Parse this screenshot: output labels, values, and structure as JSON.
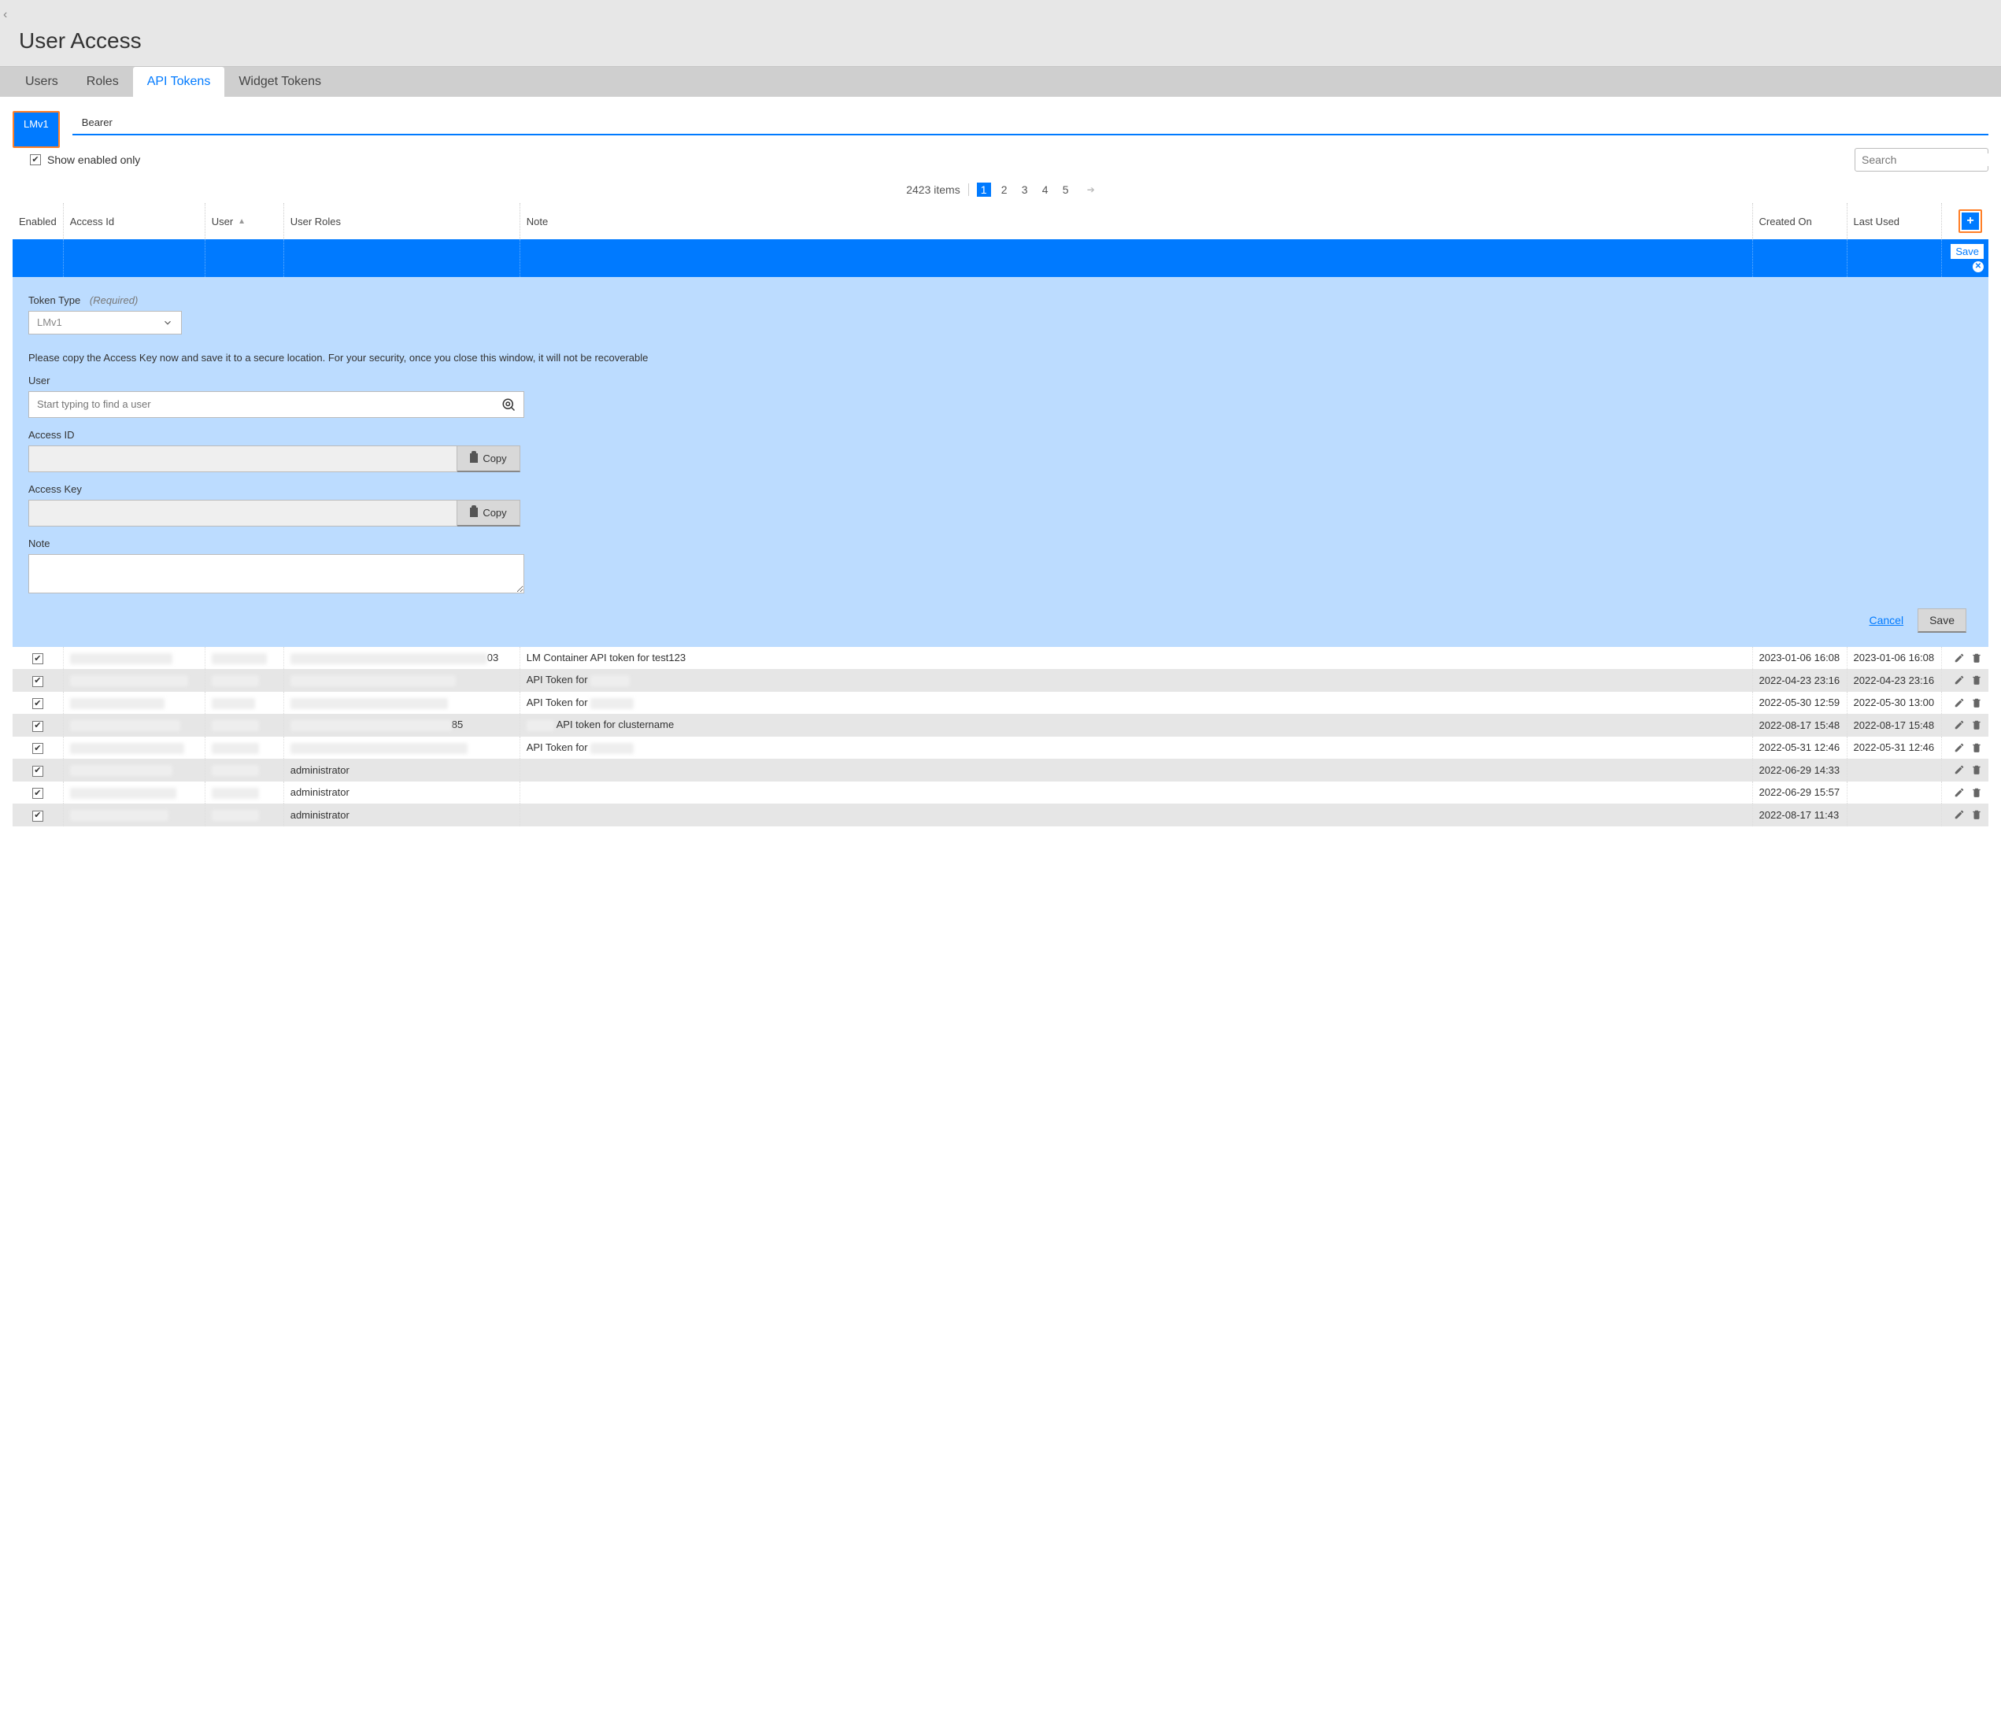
{
  "page_title": "User Access",
  "main_tabs": [
    "Users",
    "Roles",
    "API Tokens",
    "Widget Tokens"
  ],
  "active_main_tab": 2,
  "sub_tabs": [
    "LMv1",
    "Bearer"
  ],
  "active_sub_tab": 0,
  "show_enabled_only_label": "Show enabled only",
  "show_enabled_only_checked": true,
  "search_placeholder": "Search",
  "items_count_label": "2423 items",
  "pages": [
    "1",
    "2",
    "3",
    "4",
    "5"
  ],
  "active_page": 0,
  "columns": {
    "enabled": "Enabled",
    "access_id": "Access Id",
    "user": "User",
    "user_roles": "User Roles",
    "note": "Note",
    "created_on": "Created On",
    "last_used": "Last Used"
  },
  "inline_save_label": "Save",
  "form": {
    "token_type_label": "Token Type",
    "required_label": "(Required)",
    "token_type_value": "LMv1",
    "hint_text": "Please copy the Access Key now and save it to a secure location. For your security, once you close this window, it will not be recoverable",
    "user_label": "User",
    "user_placeholder": "Start typing to find a user",
    "access_id_label": "Access ID",
    "access_key_label": "Access Key",
    "copy_label": "Copy",
    "note_label": "Note",
    "cancel_label": "Cancel",
    "save_label": "Save"
  },
  "rows": [
    {
      "enabled": true,
      "access_id_width": 130,
      "user_width": 70,
      "roles_width": 250,
      "roles_suffix": "03",
      "note": "LM Container API token for test123",
      "created": "2023-01-06 16:08",
      "last_used": "2023-01-06 16:08"
    },
    {
      "enabled": true,
      "access_id_width": 150,
      "user_width": 60,
      "roles_width": 210,
      "roles_suffix": "",
      "note": "API Token for ",
      "note_redact": 50,
      "created": "2022-04-23 23:16",
      "last_used": "2022-04-23 23:16"
    },
    {
      "enabled": true,
      "access_id_width": 120,
      "user_width": 55,
      "roles_width": 200,
      "roles_suffix": "",
      "note": "API Token for ",
      "note_redact": 55,
      "created": "2022-05-30 12:59",
      "last_used": "2022-05-30 13:00"
    },
    {
      "enabled": true,
      "access_id_width": 140,
      "user_width": 60,
      "roles_width": 205,
      "roles_suffix": "85",
      "note_prefix_redact": 35,
      "note": "API token for clustername",
      "created": "2022-08-17 15:48",
      "last_used": "2022-08-17 15:48"
    },
    {
      "enabled": true,
      "access_id_width": 145,
      "user_width": 60,
      "roles_width": 225,
      "roles_suffix": "",
      "note": "API Token for ",
      "note_redact": 55,
      "created": "2022-05-31 12:46",
      "last_used": "2022-05-31 12:46"
    },
    {
      "enabled": true,
      "access_id_width": 130,
      "user_width": 60,
      "roles_text": "administrator",
      "note": "",
      "created": "2022-06-29 14:33",
      "last_used": ""
    },
    {
      "enabled": true,
      "access_id_width": 135,
      "user_width": 60,
      "roles_text": "administrator",
      "note": "",
      "created": "2022-06-29 15:57",
      "last_used": ""
    },
    {
      "enabled": true,
      "access_id_width": 125,
      "user_width": 60,
      "roles_text": "administrator",
      "note": "",
      "created": "2022-08-17 11:43",
      "last_used": ""
    }
  ]
}
